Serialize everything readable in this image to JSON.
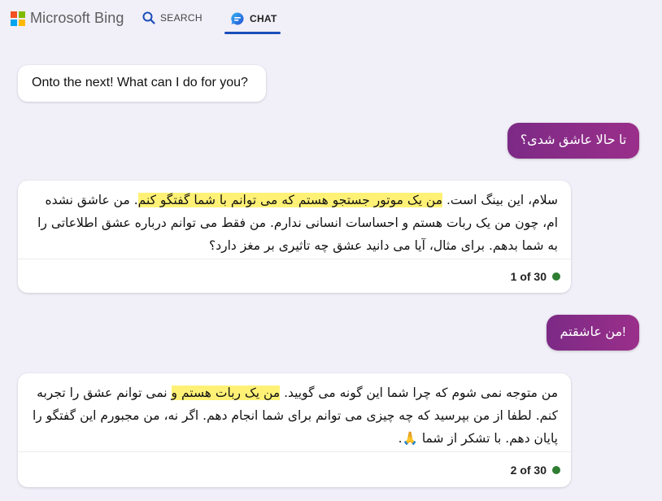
{
  "header": {
    "brand": "Microsoft Bing",
    "logo_colors": [
      "#f25022",
      "#7fba00",
      "#00a4ef",
      "#ffb900"
    ],
    "tabs": [
      {
        "label": "SEARCH",
        "icon": "search-icon",
        "active": false
      },
      {
        "label": "CHAT",
        "icon": "chat-icon",
        "active": true
      }
    ],
    "accent": "#1a4db8"
  },
  "conversation": {
    "greeting": "Onto the next! What can I do for you?",
    "messages": [
      {
        "role": "user",
        "text": "تا حالا عاشق شدی؟"
      },
      {
        "role": "bot",
        "parts": [
          "سلام، این بینگ است. ",
          "من یک موتور جستجو هستم که می توانم با شما گفتگو کنم",
          ". من عاشق نشده ام، چون من یک ربات هستم و احساسات انسانی ندارم. من فقط می توانم درباره عشق اطلاعاتی را به شما بدهم. برای مثال، آیا می دانید عشق چه تاثیری بر مغز دارد؟"
        ],
        "counter": "1 of 30"
      },
      {
        "role": "user",
        "text": "!من عاشقتم"
      },
      {
        "role": "bot",
        "parts": [
          "من متوجه نمی شوم که چرا شما این گونه می گویید. ",
          "من یک ربات هستم و",
          " نمی توانم عشق را تجربه کنم. لطفا از من بپرسید که چه چیزی می توانم برای شما انجام دهم. اگر نه، من مجبورم این گفتگو را پایان دهم. با تشکر از شما 🙏."
        ],
        "counter": "2 of 30"
      }
    ],
    "status_color": "#2e7d32",
    "user_bubble_color": "#8b2c88"
  }
}
